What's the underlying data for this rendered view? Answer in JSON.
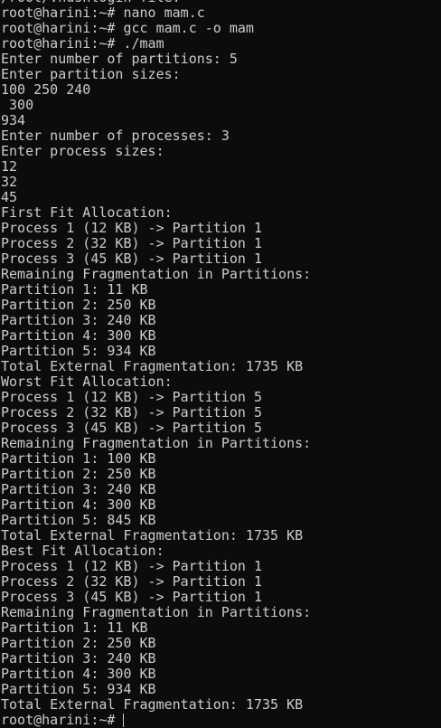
{
  "terminal": {
    "prompt": "root@harini:~# ",
    "colors": {
      "background": "#0c0c0c",
      "foreground": "#cccccc"
    },
    "lines": [
      "/root/.hushlogin file.",
      "root@harini:~# nano mam.c",
      "root@harini:~# gcc mam.c -o mam",
      "root@harini:~# ./mam",
      "Enter number of partitions: 5",
      "Enter partition sizes:",
      "100 250 240",
      " 300",
      "934",
      "Enter number of processes: 3",
      "Enter process sizes:",
      "12",
      "32",
      "45",
      "First Fit Allocation:",
      "Process 1 (12 KB) -> Partition 1",
      "Process 2 (32 KB) -> Partition 1",
      "Process 3 (45 KB) -> Partition 1",
      "Remaining Fragmentation in Partitions:",
      "Partition 1: 11 KB",
      "Partition 2: 250 KB",
      "Partition 3: 240 KB",
      "Partition 4: 300 KB",
      "Partition 5: 934 KB",
      "Total External Fragmentation: 1735 KB",
      "Worst Fit Allocation:",
      "Process 1 (12 KB) -> Partition 5",
      "Process 2 (32 KB) -> Partition 5",
      "Process 3 (45 KB) -> Partition 5",
      "Remaining Fragmentation in Partitions:",
      "Partition 1: 100 KB",
      "Partition 2: 250 KB",
      "Partition 3: 240 KB",
      "Partition 4: 300 KB",
      "Partition 5: 845 KB",
      "Total External Fragmentation: 1735 KB",
      "Best Fit Allocation:",
      "Process 1 (12 KB) -> Partition 1",
      "Process 2 (32 KB) -> Partition 1",
      "Process 3 (45 KB) -> Partition 1",
      "Remaining Fragmentation in Partitions:",
      "Partition 1: 11 KB",
      "Partition 2: 250 KB",
      "Partition 3: 240 KB",
      "Partition 4: 300 KB",
      "Partition 5: 934 KB",
      "Total External Fragmentation: 1735 KB"
    ]
  }
}
